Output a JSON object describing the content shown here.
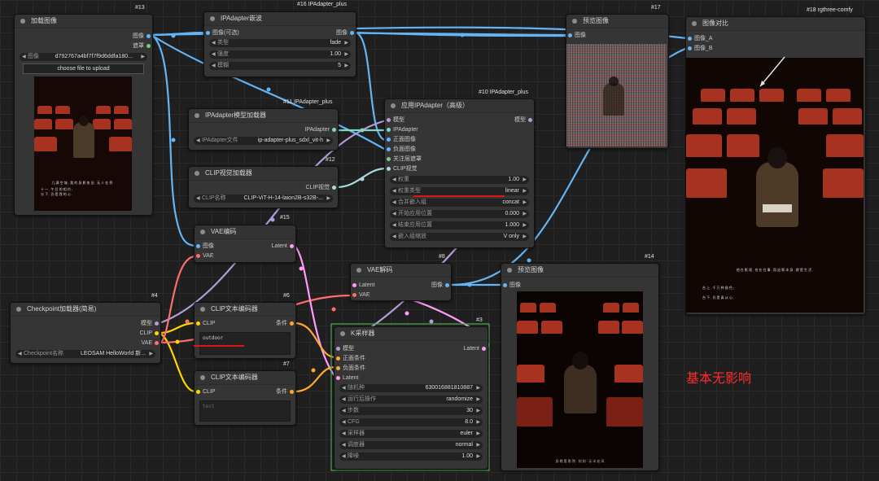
{
  "colors": {
    "image": "#64b5f6",
    "mask": "#81c784",
    "model": "#b39ddb",
    "ipadapter": "#80d8c0",
    "clip": "#ffd500",
    "vae": "#ff6e6e",
    "latent": "#ff9cf9",
    "conditioning": "#ffa931",
    "clip_vision": "#a8dadc",
    "annotation": "#ff2a2a",
    "group_border": "#4caf50"
  },
  "nodes": {
    "load_image": {
      "badge": "#13",
      "title": "加载图像",
      "outputs": [
        "图像",
        "遮罩"
      ],
      "image_widget": {
        "label": "图像",
        "value": "d792767a4bf7f7f9d6ddfa180..."
      },
      "upload_button": "choose file to upload",
      "preview_caption_1": "几 满 空 城 , 我 的 身 影 依 旧 . 无 人 在 旁 .",
      "preview_caption_2": "十 一 , 午 后 的 相 约 ;",
      "preview_caption_3": "分 下 , 仍 是 我 的 心 ."
    },
    "ipa_tiles": {
      "badge": "#16 IPAdapter_plus",
      "title": "IPAdapter嵌波",
      "inputs": [
        "图像(可选)"
      ],
      "outputs": [
        "图像"
      ],
      "widgets": [
        {
          "label": "类型",
          "value": "fade"
        },
        {
          "label": "强度",
          "value": "1.00"
        },
        {
          "label": "模糊",
          "value": "5"
        }
      ]
    },
    "ipa_model_loader": {
      "badge": "#11 IPAdapter_plus",
      "title": "IPAdapter模型加载器",
      "outputs": [
        "IPAdapter"
      ],
      "widgets": [
        {
          "label": "IPAdapter文件",
          "value": "ip-adapter-plus_sdxl_vit-h"
        }
      ]
    },
    "clip_vision_loader": {
      "badge": "#12",
      "title": "CLIP视觉加载器",
      "outputs": [
        "CLIP视觉"
      ],
      "widgets": [
        {
          "label": "CLIP名称",
          "value": "CLIP-ViT-H-14-laion2B-s32B-..."
        }
      ]
    },
    "ipa_advanced": {
      "badge": "#10 IPAdapter_plus",
      "title": "应用IPAdapter（高级）",
      "inputs": [
        "模型",
        "IPAdapter",
        "正面图像",
        "负面图像",
        "关注层遮罩",
        "CLIP视觉"
      ],
      "outputs": [
        "模型"
      ],
      "widgets": [
        {
          "label": "权重",
          "value": "1.00"
        },
        {
          "label": "权重类型",
          "value": "linear"
        },
        {
          "label": "合并嵌入组",
          "value": "concat"
        },
        {
          "label": "开始应用位置",
          "value": "0.000"
        },
        {
          "label": "结束应用位置",
          "value": "1.000"
        },
        {
          "label": "嵌入组缩放",
          "value": "V only"
        }
      ]
    },
    "preview_17": {
      "badge": "#17",
      "title": "预览图像",
      "inputs": [
        "图像"
      ]
    },
    "compare_18": {
      "badge": "#18 rgthree-comfy",
      "title": "图像对比",
      "inputs": [
        "图像_A",
        "图像_B"
      ],
      "caption_1": "他 在 影 境 , 也 在 往 事 , 而 这 影 本 身 , 就 是 生 活 .",
      "caption_2": "台 上 , 千 万 种 角 色 ;",
      "caption_3": "台 下 , 仍 是 真 从 心 ."
    },
    "vae_encode": {
      "badge": "#15",
      "title": "VAE编码",
      "inputs": [
        "图像",
        "VAE"
      ],
      "outputs": [
        "Latent"
      ]
    },
    "vae_decode": {
      "badge": "#8",
      "title": "VAE解码",
      "inputs": [
        "Latent",
        "VAE"
      ],
      "outputs": [
        "图像"
      ]
    },
    "preview_14": {
      "badge": "#14",
      "title": "预览图像",
      "inputs": [
        "图像"
      ],
      "caption": "身 晚 套 影 院 · 刻 刻 · 无 半 处 风"
    },
    "checkpoint": {
      "badge": "#4",
      "title": "Checkpoint加载器(简易)",
      "outputs": [
        "模型",
        "CLIP",
        "VAE"
      ],
      "widgets": [
        {
          "label": "Checkpoint名称",
          "value": "LEOSAM HelloWorld 新..."
        }
      ]
    },
    "clip_text_pos": {
      "badge": "#6",
      "title": "CLIP文本编码器",
      "inputs": [
        "CLIP"
      ],
      "outputs": [
        "条件"
      ],
      "text": "outdoor"
    },
    "clip_text_neg": {
      "badge": "#7",
      "title": "CLIP文本编码器",
      "inputs": [
        "CLIP"
      ],
      "outputs": [
        "条件"
      ],
      "text": "text"
    },
    "ksampler": {
      "badge": "#3",
      "title": "K采样器",
      "inputs": [
        "模型",
        "正面条件",
        "负面条件",
        "Latent"
      ],
      "outputs": [
        "Latent"
      ],
      "widgets": [
        {
          "label": "随机种",
          "value": "630016881810887"
        },
        {
          "label": "运行后操作",
          "value": "randomize"
        },
        {
          "label": "步数",
          "value": "30"
        },
        {
          "label": "CFG",
          "value": "8.0"
        },
        {
          "label": "采样器",
          "value": "euler"
        },
        {
          "label": "调度器",
          "value": "normal"
        },
        {
          "label": "降噪",
          "value": "1.00"
        }
      ]
    }
  },
  "annotation": {
    "text": "基本无影响"
  }
}
